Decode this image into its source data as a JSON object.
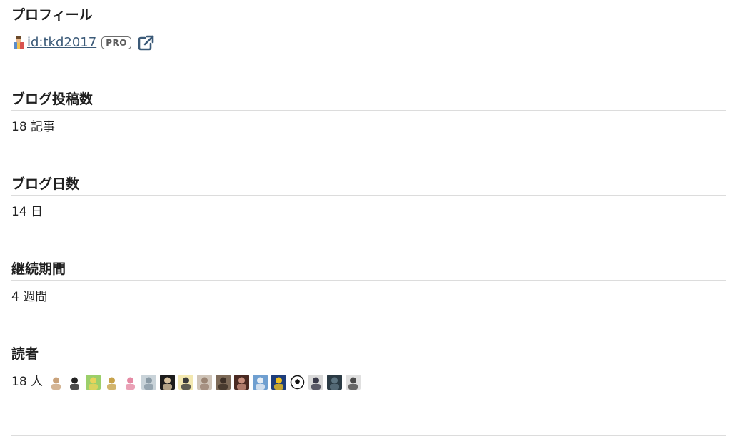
{
  "profile": {
    "title": "プロフィール",
    "user_id": " id:tkd2017 ",
    "badge": "PRO",
    "icons": {
      "avatar": "user-avatar-icon",
      "external": "external-link-icon"
    },
    "link_color": "#3b5a78"
  },
  "posts": {
    "title": "ブログ投稿数",
    "value": "18 記事"
  },
  "days": {
    "title": "ブログ日数",
    "value": "14 日"
  },
  "period": {
    "title": "継続期間",
    "value": "4 週間"
  },
  "readers": {
    "title": "読者",
    "count": "18 人",
    "avatars": [
      {
        "name": "reader-avatar-1",
        "icon": "figure-avatar",
        "colors": [
          "#ffffff",
          "#c9a27a"
        ]
      },
      {
        "name": "reader-avatar-2",
        "icon": "girl-avatar",
        "colors": [
          "#ffffff",
          "#222222"
        ]
      },
      {
        "name": "reader-avatar-3",
        "icon": "landscape-avatar",
        "colors": [
          "#9ccf6a",
          "#e9d35b"
        ]
      },
      {
        "name": "reader-avatar-4",
        "icon": "sign-avatar",
        "colors": [
          "#ffffff",
          "#c7a24a"
        ]
      },
      {
        "name": "reader-avatar-5",
        "icon": "flower-avatar",
        "colors": [
          "#ffffff",
          "#e58aa4"
        ]
      },
      {
        "name": "reader-avatar-6",
        "icon": "photo-avatar",
        "colors": [
          "#c9d3d9",
          "#8a9aa5"
        ]
      },
      {
        "name": "reader-avatar-7",
        "icon": "person-avatar",
        "colors": [
          "#1c1c1c",
          "#d8c3a0"
        ]
      },
      {
        "name": "reader-avatar-8",
        "icon": "face-avatar",
        "colors": [
          "#f3e8b0",
          "#3a3a3a"
        ]
      },
      {
        "name": "reader-avatar-9",
        "icon": "photo-avatar",
        "colors": [
          "#cfc4b8",
          "#9b8574"
        ]
      },
      {
        "name": "reader-avatar-10",
        "icon": "photo-avatar",
        "colors": [
          "#7d6a58",
          "#3c2f26"
        ]
      },
      {
        "name": "reader-avatar-11",
        "icon": "person-avatar",
        "colors": [
          "#4a2a22",
          "#c78f7d"
        ]
      },
      {
        "name": "reader-avatar-12",
        "icon": "sky-avatar",
        "colors": [
          "#6f9fd0",
          "#e8eef4"
        ]
      },
      {
        "name": "reader-avatar-13",
        "icon": "character-avatar",
        "colors": [
          "#1d3d7a",
          "#f0c020"
        ]
      },
      {
        "name": "reader-avatar-14",
        "icon": "soccer-ball-avatar",
        "colors": [
          "#ffffff",
          "#111111"
        ]
      },
      {
        "name": "reader-avatar-15",
        "icon": "dark-person-avatar",
        "colors": [
          "#d9d9d9",
          "#3a3a4a"
        ]
      },
      {
        "name": "reader-avatar-16",
        "icon": "dark-photo-avatar",
        "colors": [
          "#2b3b45",
          "#5c7380"
        ]
      },
      {
        "name": "reader-avatar-17",
        "icon": "plant-avatar",
        "colors": [
          "#e0e0e0",
          "#4a4a4a"
        ]
      }
    ]
  }
}
